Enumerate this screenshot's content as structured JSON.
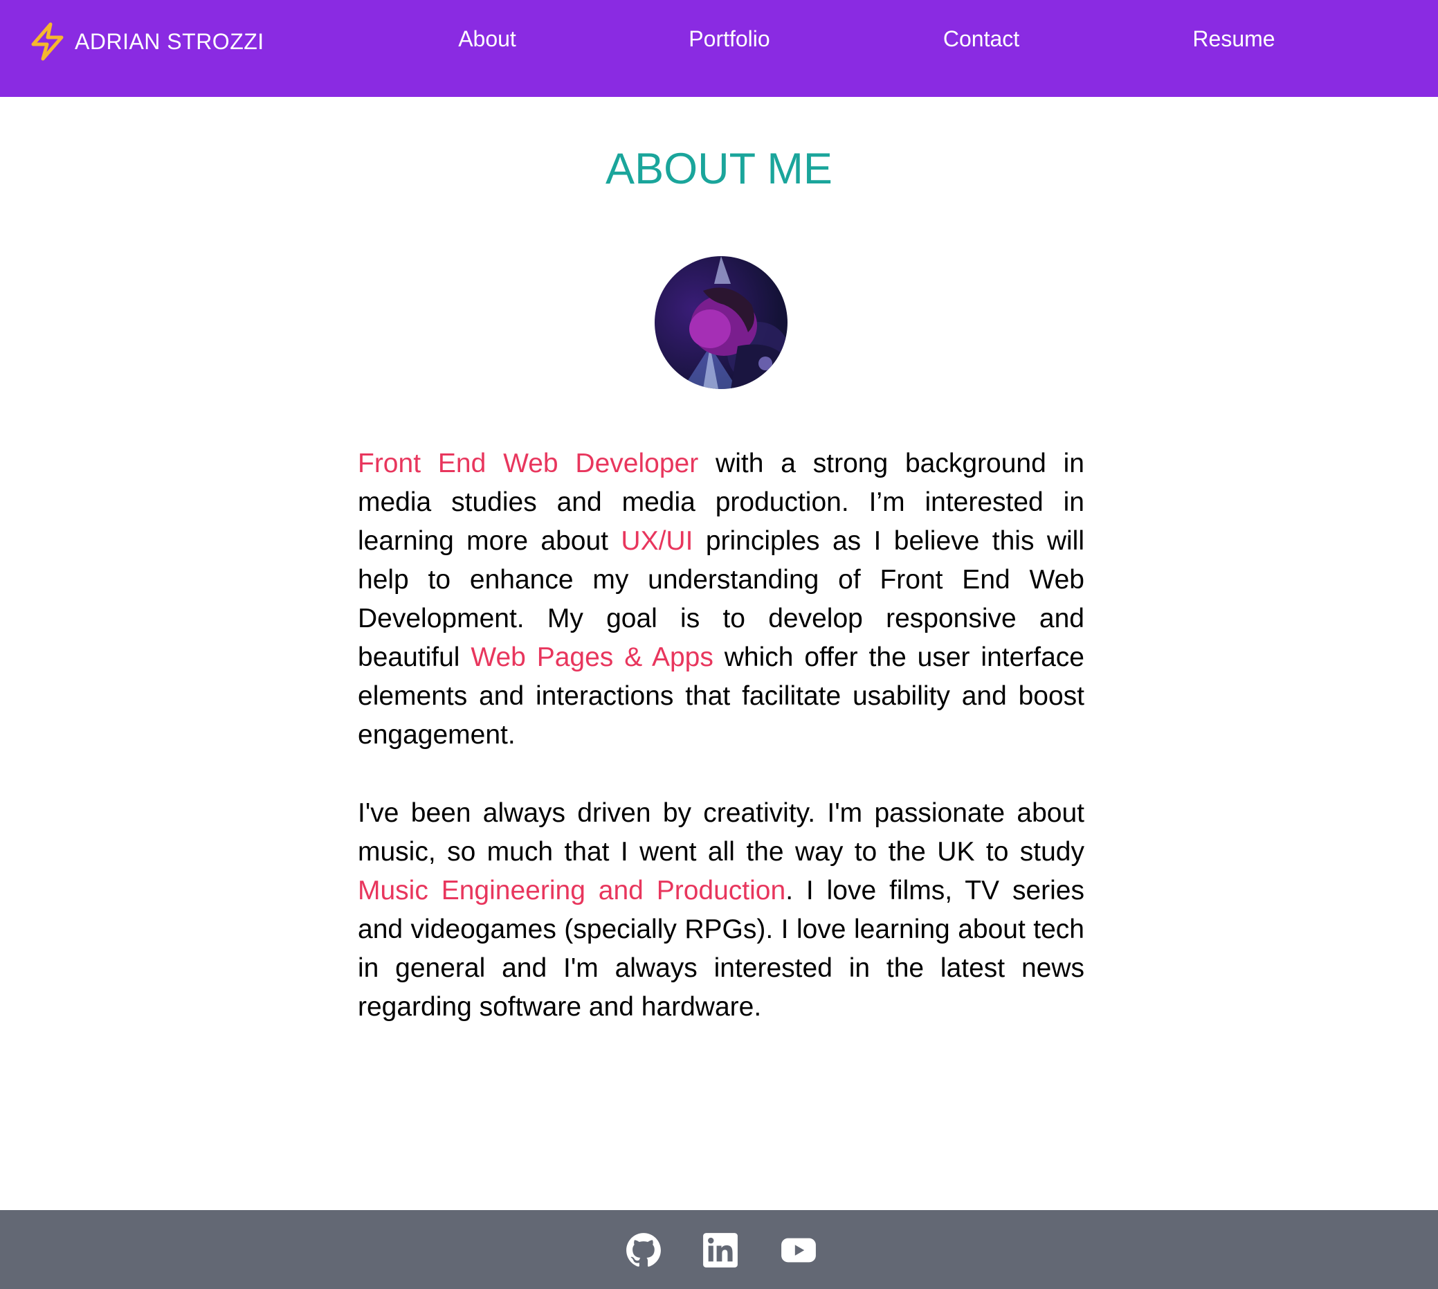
{
  "header": {
    "brand": {
      "name": "ADRIAN STROZZI",
      "icon": "lightning-bolt-icon",
      "icon_color": "#f5b82e"
    },
    "nav": [
      {
        "label": "About"
      },
      {
        "label": "Portfolio"
      },
      {
        "label": "Contact"
      },
      {
        "label": "Resume"
      }
    ],
    "background_color": "#8a2be2"
  },
  "main": {
    "title": "ABOUT ME",
    "title_color": "#1aa59b",
    "highlight_color": "#e8365d",
    "paragraph1": {
      "h1": "Front End Web Developer",
      "t1": " with a strong background in media studies and media production. I’m interested in learning more about ",
      "h2": "UX/UI",
      "t2": " principles as I believe this will help to enhance my understanding of Front End Web Development. My goal is to develop responsive and beautiful ",
      "h3": "Web Pages & Apps",
      "t3": " which offer the user interface elements and interactions that facilitate usability and boost engagement."
    },
    "paragraph2": {
      "t1": "I've been always driven by creativity. I'm passionate about music, so much that I went all the way to the UK to study ",
      "h1": "Music Engineering and Production",
      "t2": ". I love films, TV series and videogames (specially RPGs). I love learning about tech in general and I'm always interested in the latest news regarding software and hardware."
    }
  },
  "footer": {
    "background_color": "#636874",
    "social": [
      {
        "icon": "github-icon"
      },
      {
        "icon": "linkedin-icon"
      },
      {
        "icon": "youtube-icon"
      }
    ]
  }
}
